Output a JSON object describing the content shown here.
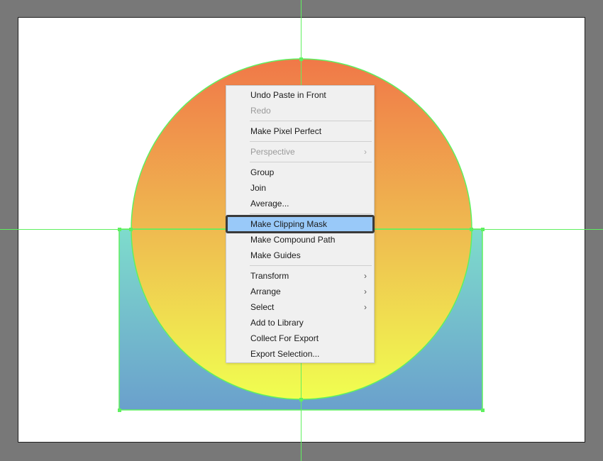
{
  "colors": {
    "workspace": "#787878",
    "artboard": "#ffffff",
    "guide": "#5ff05f",
    "selection": "#5ff05f",
    "circle_top": "#f07848",
    "circle_bottom": "#f0ff50",
    "rect_top": "#7edccc",
    "rect_bottom": "#6aa0cc",
    "menu_bg": "#f0f0f0",
    "menu_highlight": "#99c9f9"
  },
  "context_menu": {
    "items": [
      {
        "label": "Undo Paste in Front",
        "enabled": true,
        "submenu": false
      },
      {
        "label": "Redo",
        "enabled": false,
        "submenu": false
      },
      {
        "label": "Make Pixel Perfect",
        "enabled": true,
        "submenu": false
      },
      {
        "label": "Perspective",
        "enabled": false,
        "submenu": true
      },
      {
        "label": "Group",
        "enabled": true,
        "submenu": false
      },
      {
        "label": "Join",
        "enabled": true,
        "submenu": false
      },
      {
        "label": "Average...",
        "enabled": true,
        "submenu": false
      },
      {
        "label": "Make Clipping Mask",
        "enabled": true,
        "submenu": false,
        "highlighted": true
      },
      {
        "label": "Make Compound Path",
        "enabled": true,
        "submenu": false
      },
      {
        "label": "Make Guides",
        "enabled": true,
        "submenu": false
      },
      {
        "label": "Transform",
        "enabled": true,
        "submenu": true
      },
      {
        "label": "Arrange",
        "enabled": true,
        "submenu": true
      },
      {
        "label": "Select",
        "enabled": true,
        "submenu": true
      },
      {
        "label": "Add to Library",
        "enabled": true,
        "submenu": false
      },
      {
        "label": "Collect For Export",
        "enabled": true,
        "submenu": false
      },
      {
        "label": "Export Selection...",
        "enabled": true,
        "submenu": false
      }
    ],
    "submenu_glyph": "›"
  }
}
